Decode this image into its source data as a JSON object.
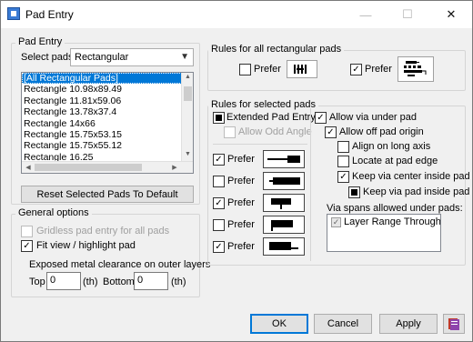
{
  "window": {
    "title": "Pad Entry",
    "minimize_glyph": "—",
    "maximize_glyph": "☐",
    "close_glyph": "✕"
  },
  "pad_entry": {
    "group_label": "Pad Entry",
    "select_label": "Select pads:",
    "select_value": "Rectangular",
    "list_items": [
      "[All Rectangular Pads]",
      "Rectangle 10.98x89.49",
      "Rectangle 11.81x59.06",
      "Rectangle 13.78x37.4",
      "Rectangle 14x66",
      "Rectangle 15.75x53.15",
      "Rectangle 15.75x55.12",
      "Rectangle 16.25"
    ],
    "reset_button": "Reset Selected Pads To Default"
  },
  "general": {
    "group_label": "General options",
    "gridless_label": "Gridless pad entry for all pads",
    "fitview_label": "Fit view / highlight pad",
    "clearance_label": "Exposed metal clearance on outer layers",
    "top_label": "Top",
    "top_value": "0",
    "top_unit": "(th)",
    "bottom_label": "Bottom",
    "bottom_value": "0",
    "bottom_unit": "(th)"
  },
  "rules_all": {
    "group_label": "Rules for all rectangular pads",
    "prefer1_label": "Prefer",
    "prefer2_label": "Prefer"
  },
  "rules_selected": {
    "group_label": "Rules for selected pads",
    "extended_label": "Extended Pad Entry",
    "odd_angle_label": "Allow Odd Angle",
    "prefer_rows": [
      {
        "label": "Prefer",
        "checked": true
      },
      {
        "label": "Prefer",
        "checked": false
      },
      {
        "label": "Prefer",
        "checked": true
      },
      {
        "label": "Prefer",
        "checked": false
      },
      {
        "label": "Prefer",
        "checked": true
      }
    ],
    "allow_via_label": "Allow via under pad",
    "allow_off_label": "Allow off pad origin",
    "align_long_label": "Align on long axis",
    "locate_edge_label": "Locate at pad edge",
    "keep_center_label": "Keep via center inside pad",
    "keep_inside_label": "Keep via pad inside pad",
    "via_spans_label": "Via spans allowed under pads:",
    "layer_range_label": "Layer Range Through"
  },
  "footer": {
    "ok": "OK",
    "cancel": "Cancel",
    "apply": "Apply"
  },
  "icons": {
    "check": "✓",
    "dropdown": "▼",
    "up": "▲",
    "down": "▼",
    "left": "◀",
    "right": "▶"
  }
}
